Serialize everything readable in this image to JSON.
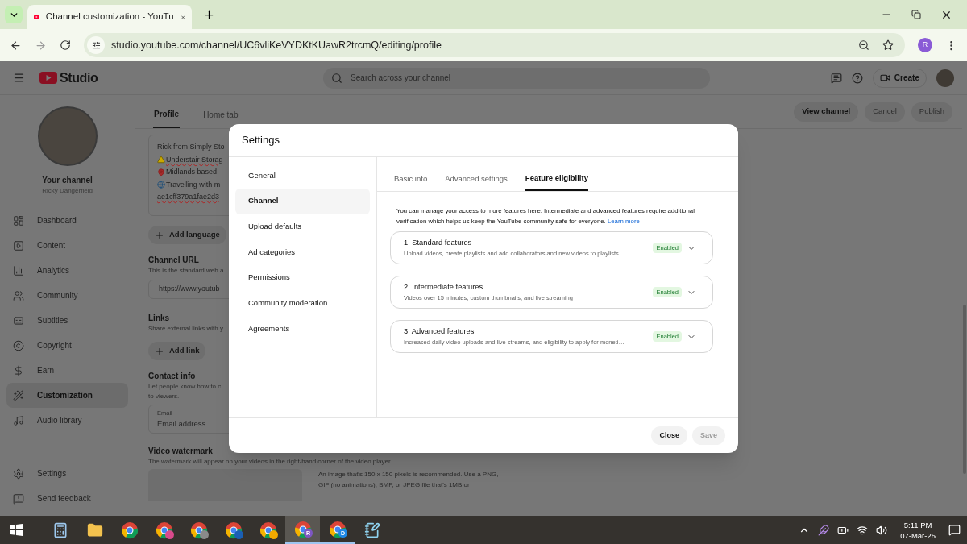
{
  "browser": {
    "tab_title": "Channel customization - YouTu",
    "url": "studio.youtube.com/channel/UC6vliKeVYDKtKUawR2trcmQ/editing/profile",
    "profile_initial": "R"
  },
  "studio": {
    "logo_text": "Studio",
    "search_placeholder": "Search across your channel",
    "create_label": "Create"
  },
  "sidebar": {
    "channel_title": "Your channel",
    "channel_name": "Ricky Dangerfield",
    "items": [
      {
        "label": "Dashboard",
        "selected": false
      },
      {
        "label": "Content",
        "selected": false
      },
      {
        "label": "Analytics",
        "selected": false
      },
      {
        "label": "Community",
        "selected": false
      },
      {
        "label": "Subtitles",
        "selected": false
      },
      {
        "label": "Copyright",
        "selected": false
      },
      {
        "label": "Earn",
        "selected": false
      },
      {
        "label": "Customization",
        "selected": true
      },
      {
        "label": "Audio library",
        "selected": false
      }
    ],
    "bottom_items": [
      {
        "label": "Settings",
        "selected": false
      },
      {
        "label": "Send feedback",
        "selected": false
      }
    ]
  },
  "page": {
    "tabs": [
      {
        "label": "Profile",
        "selected": true
      },
      {
        "label": "Home tab",
        "selected": false
      }
    ],
    "buttons": [
      {
        "label": "View channel",
        "disabled": false
      },
      {
        "label": "Cancel",
        "disabled": true
      },
      {
        "label": "Publish",
        "disabled": true
      }
    ],
    "description_lines": [
      {
        "text": "Rick from Simply Sto",
        "misspelled": false
      },
      {
        "text": "Understair Storag",
        "misspelled": true
      },
      {
        "text": "Midlands based",
        "misspelled": false
      },
      {
        "text": "Travelling with m",
        "misspelled": false
      },
      {
        "text": "ae1cff379a1fae2d3",
        "misspelled": true
      }
    ],
    "add_language": "Add language",
    "channel_url": {
      "title": "Channel URL",
      "description": "This is the standard web a",
      "value": "https://www.youtub"
    },
    "links": {
      "title": "Links",
      "description": "Share external links with y",
      "add_label": "Add link"
    },
    "contact": {
      "title": "Contact info",
      "description_lines": [
        "Let people know how to c",
        "to viewers."
      ],
      "email_label": "Email",
      "email_placeholder": "Email address"
    },
    "watermark": {
      "title": "Video watermark",
      "description": "The watermark will appear on your videos in the right-hand corner of the video player",
      "hint": "An image that's 150 x 150 pixels is recommended. Use a PNG, GIF (no animations), BMP, or JPEG file that's 1MB or"
    }
  },
  "modal": {
    "title": "Settings",
    "nav": [
      {
        "label": "General",
        "selected": false
      },
      {
        "label": "Channel",
        "selected": true
      },
      {
        "label": "Upload defaults",
        "selected": false
      },
      {
        "label": "Ad categories",
        "selected": false
      },
      {
        "label": "Permissions",
        "selected": false
      },
      {
        "label": "Community moderation",
        "selected": false
      },
      {
        "label": "Agreements",
        "selected": false
      }
    ],
    "tabs": [
      {
        "label": "Basic info",
        "selected": false
      },
      {
        "label": "Advanced settings",
        "selected": false
      },
      {
        "label": "Feature eligibility",
        "selected": true
      }
    ],
    "intro": "You can manage your access to more features here. Intermediate and advanced features require additional verification which helps us keep the YouTube community safe for everyone.",
    "learn_more": "Learn more",
    "features": [
      {
        "title": "1. Standard features",
        "description": "Upload videos, create playlists and add collaborators and new videos to playlists",
        "status": "Enabled",
        "expanded": false
      },
      {
        "title": "2. Intermediate features",
        "description": "Videos over 15 minutes, custom thumbnails, and live streaming",
        "status": "Enabled",
        "expanded": false
      },
      {
        "title": "3. Advanced features",
        "description": "Increased daily video uploads and live streams, and eligibility to apply for moneti…",
        "status": "Enabled",
        "expanded": false
      }
    ],
    "buttons": [
      {
        "label": "Close",
        "disabled": false
      },
      {
        "label": "Save",
        "disabled": true
      }
    ]
  },
  "taskbar": {
    "apps": [
      {
        "kind": "calculator",
        "active": false,
        "running": false
      },
      {
        "kind": "explorer",
        "active": false,
        "running": false
      },
      {
        "kind": "chrome",
        "active": false,
        "running": false
      },
      {
        "kind": "chrome",
        "color": "#d94a8c",
        "active": false,
        "running": false
      },
      {
        "kind": "chrome",
        "color": "#8a8a8a",
        "active": false,
        "running": false
      },
      {
        "kind": "chrome",
        "color": "#1a5fb4",
        "active": false,
        "running": false
      },
      {
        "kind": "chrome",
        "color": "#f2a900",
        "active": false,
        "running": false
      },
      {
        "kind": "chrome",
        "badge": "R",
        "color": "#7e57c2",
        "active": true,
        "running": true
      },
      {
        "kind": "chrome",
        "badge": "D",
        "color": "#1e88e5",
        "active": false,
        "running": true
      },
      {
        "kind": "notepad",
        "active": false,
        "running": false
      }
    ],
    "time": "5:11 PM",
    "date": "07-Mar-25"
  }
}
